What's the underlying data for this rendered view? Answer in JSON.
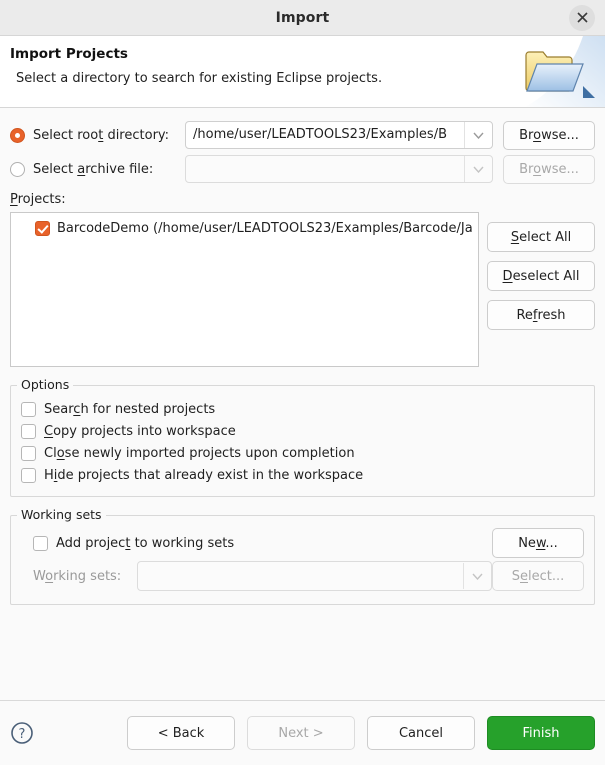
{
  "window": {
    "title": "Import",
    "close_icon": "close-icon"
  },
  "header": {
    "title": "Import Projects",
    "subtitle": "Select a directory to search for existing Eclipse projects.",
    "icon": "import-folder-icon"
  },
  "source": {
    "root_directory": {
      "label_before": "Select roo",
      "label_mnemonic": "t",
      "label_after": " directory:",
      "selected": true,
      "value": "/home/user/LEADTOOLS23/Examples/B",
      "browse": {
        "before": "Br",
        "mnemonic": "o",
        "after": "wse..."
      }
    },
    "archive_file": {
      "label_before": "Select ",
      "label_mnemonic": "a",
      "label_after": "rchive file:",
      "selected": false,
      "value": "",
      "browse": {
        "before": "Br",
        "mnemonic": "o",
        "after": "wse..."
      }
    }
  },
  "projects": {
    "label_mnemonic": "P",
    "label_after": "rojects:",
    "items": [
      {
        "checked": true,
        "text": "BarcodeDemo (/home/user/LEADTOOLS23/Examples/Barcode/Ja"
      }
    ],
    "buttons": [
      {
        "before": "",
        "mnemonic": "S",
        "after": "elect All"
      },
      {
        "before": "",
        "mnemonic": "D",
        "after": "eselect All"
      },
      {
        "before": "Re",
        "mnemonic": "f",
        "after": "resh"
      }
    ]
  },
  "options": {
    "title": "Options",
    "items": [
      {
        "checked": false,
        "before": "Sear",
        "mnemonic": "c",
        "after": "h for nested projects"
      },
      {
        "checked": false,
        "before": "",
        "mnemonic": "C",
        "after": "opy projects into workspace"
      },
      {
        "checked": false,
        "before": "Cl",
        "mnemonic": "o",
        "after": "se newly imported projects upon completion"
      },
      {
        "checked": false,
        "before": "H",
        "mnemonic": "i",
        "after": "de projects that already exist in the workspace"
      }
    ]
  },
  "working_sets": {
    "title": "Working sets",
    "add_checkbox": {
      "checked": false,
      "before": "Add projec",
      "mnemonic": "t",
      "after": " to working sets"
    },
    "new_button": {
      "before": "Ne",
      "mnemonic": "w",
      "after": "..."
    },
    "combo_label": {
      "before": "W",
      "mnemonic": "o",
      "after": "rking sets:"
    },
    "combo_value": "",
    "select_button": {
      "before": "S",
      "mnemonic": "e",
      "after": "lect..."
    }
  },
  "footer": {
    "help_icon": "help-icon",
    "back": "< Back",
    "next": "Next >",
    "cancel": "Cancel",
    "finish": "Finish"
  },
  "colors": {
    "accent": "#e8622a",
    "finish_green": "#26a12b",
    "title_bar": "#ebebeb",
    "dialog_bg": "#fafafa"
  }
}
